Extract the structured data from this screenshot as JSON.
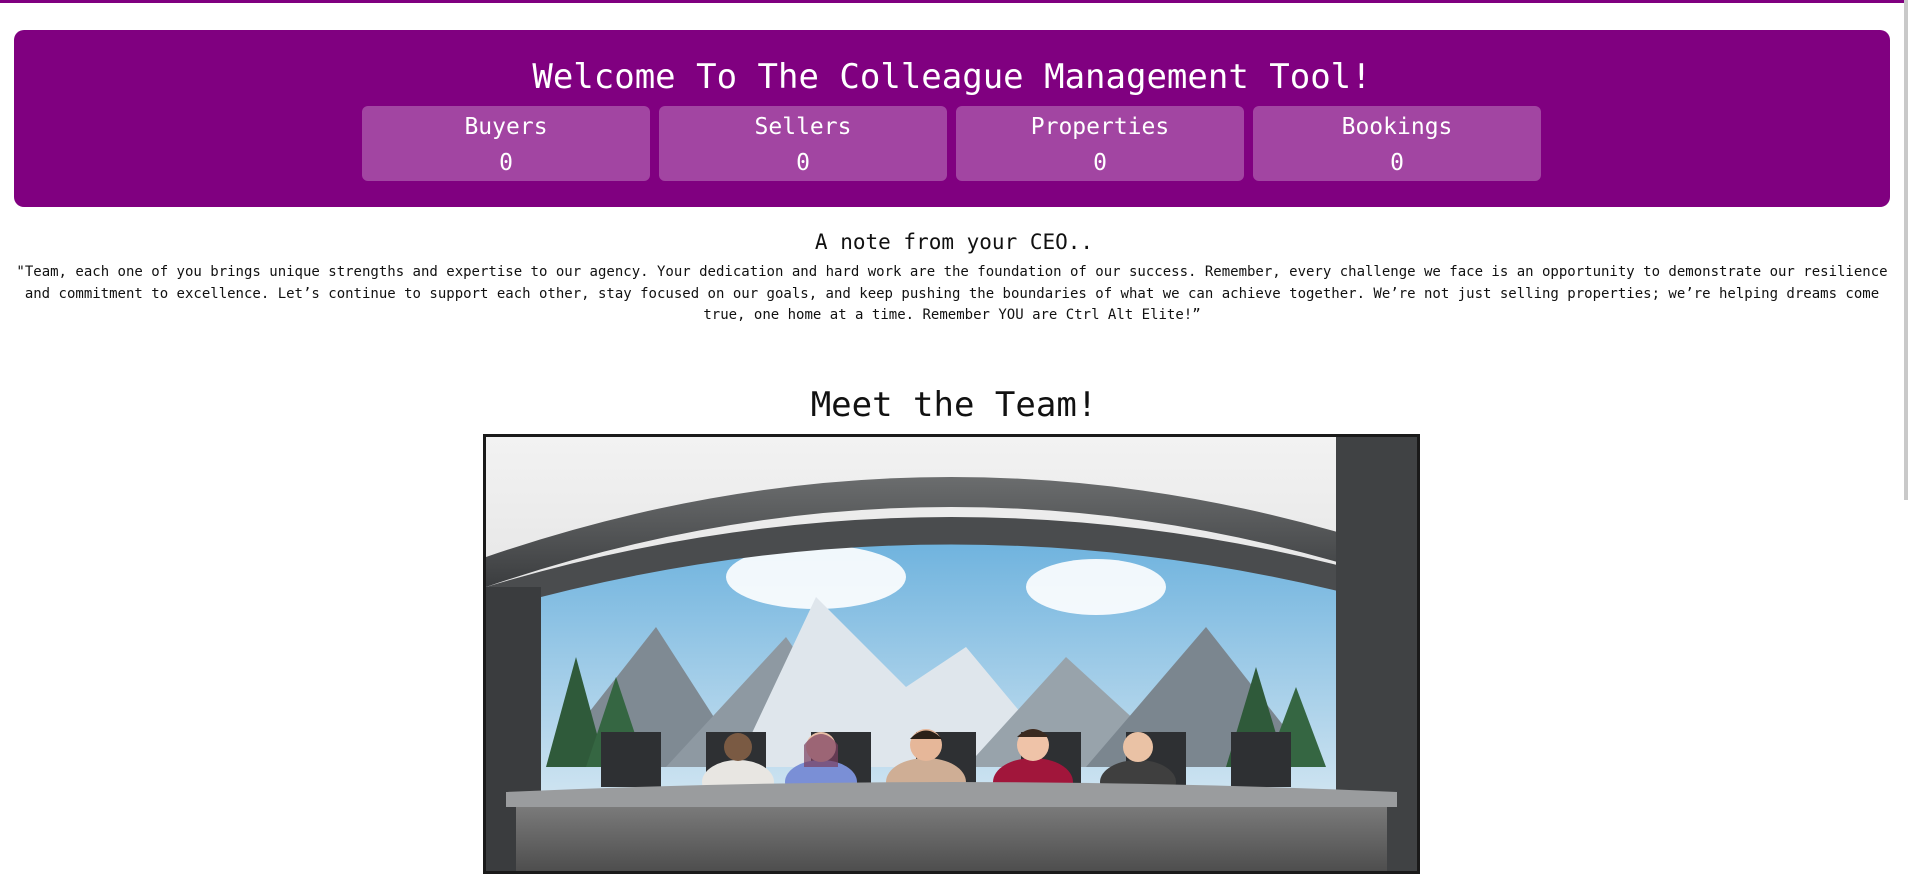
{
  "page": {
    "title": "Welcome To The Colleague Management Tool!",
    "accent_color": "#800080"
  },
  "stats": [
    {
      "label": "Buyers",
      "value": "0"
    },
    {
      "label": "Sellers",
      "value": "0"
    },
    {
      "label": "Properties",
      "value": "0"
    },
    {
      "label": "Bookings",
      "value": "0"
    }
  ],
  "ceo_note": {
    "heading": "A note from your CEO..",
    "quote": "\"Team, each one of you brings unique strengths and expertise to our agency. Your dedication and hard work are the foundation of our success. Remember, every challenge we face is an opportunity to demonstrate our resilience and commitment to excellence. Let’s continue to support each other, stay focused on our goals, and keep pushing the boundaries of what we can achieve together. We’re not just selling properties; we’re helping dreams come true, one home at a time. Remember YOU are Ctrl Alt Elite!”"
  },
  "team": {
    "heading": "Meet the Team!",
    "photo_description": "team-photo",
    "member_count": 5
  }
}
